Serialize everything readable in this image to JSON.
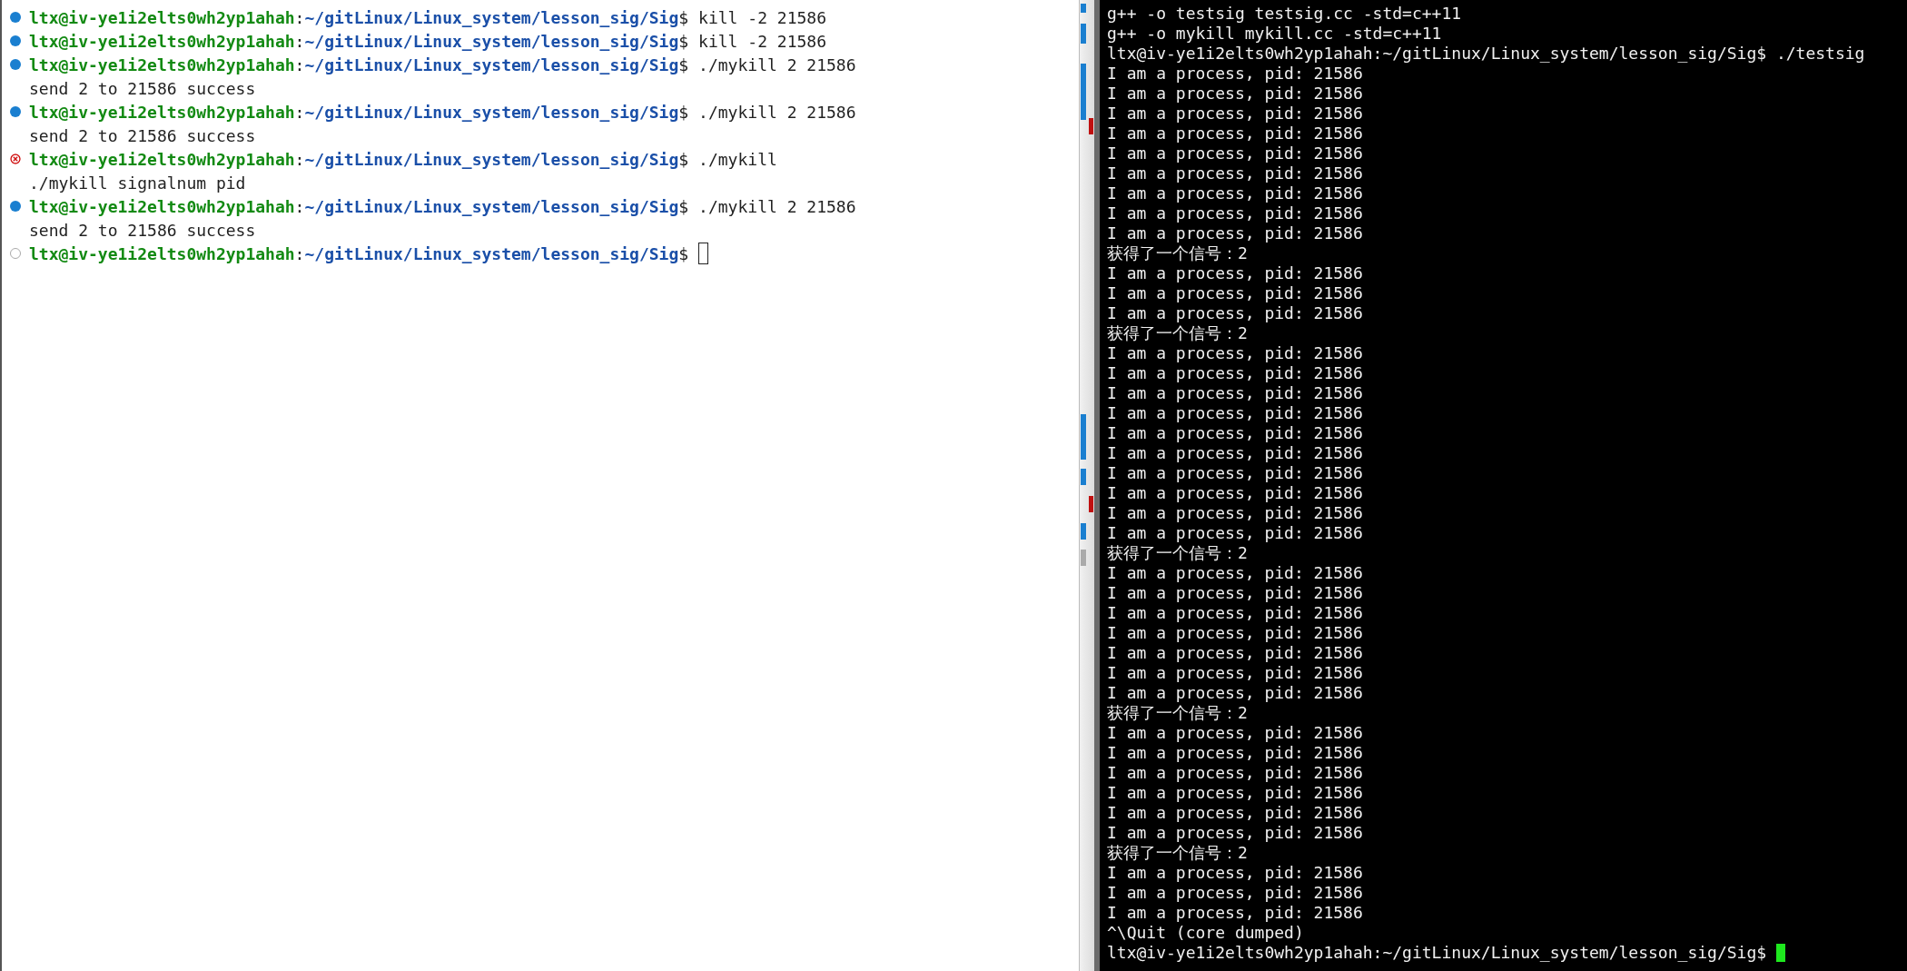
{
  "left_terminal": {
    "cursor": true,
    "lines": [
      {
        "kind": "prompt",
        "marker": {
          "kind": "success"
        },
        "user_host": "ltx@iv-ye1i2elts0wh2yp1ahah",
        "separator": ":",
        "path": "~/gitLinux/Linux_system/lesson_sig/Sig",
        "sigil": "$",
        "command": "kill -2 21586"
      },
      {
        "kind": "prompt",
        "marker": {
          "kind": "success"
        },
        "user_host": "ltx@iv-ye1i2elts0wh2yp1ahah",
        "separator": ":",
        "path": "~/gitLinux/Linux_system/lesson_sig/Sig",
        "sigil": "$",
        "command": "kill -2 21586"
      },
      {
        "kind": "prompt",
        "marker": {
          "kind": "success"
        },
        "user_host": "ltx@iv-ye1i2elts0wh2yp1ahah",
        "separator": ":",
        "path": "~/gitLinux/Linux_system/lesson_sig/Sig",
        "sigil": "$",
        "command": "./mykill 2 21586"
      },
      {
        "kind": "output",
        "text": "send 2 to 21586 success"
      },
      {
        "kind": "prompt",
        "marker": {
          "kind": "success"
        },
        "user_host": "ltx@iv-ye1i2elts0wh2yp1ahah",
        "separator": ":",
        "path": "~/gitLinux/Linux_system/lesson_sig/Sig",
        "sigil": "$",
        "command": "./mykill 2 21586"
      },
      {
        "kind": "output",
        "text": "send 2 to 21586 success"
      },
      {
        "kind": "prompt",
        "marker": {
          "kind": "error"
        },
        "user_host": "ltx@iv-ye1i2elts0wh2yp1ahah",
        "separator": ":",
        "path": "~/gitLinux/Linux_system/lesson_sig/Sig",
        "sigil": "$",
        "command": "./mykill"
      },
      {
        "kind": "output",
        "text": "./mykill signalnum pid"
      },
      {
        "kind": "prompt",
        "marker": {
          "kind": "success"
        },
        "user_host": "ltx@iv-ye1i2elts0wh2yp1ahah",
        "separator": ":",
        "path": "~/gitLinux/Linux_system/lesson_sig/Sig",
        "sigil": "$",
        "command": "./mykill 2 21586"
      },
      {
        "kind": "output",
        "text": "send 2 to 21586 success"
      },
      {
        "kind": "prompt",
        "marker": {
          "kind": "pending"
        },
        "user_host": "ltx@iv-ye1i2elts0wh2yp1ahah",
        "separator": ":",
        "path": "~/gitLinux/Linux_system/lesson_sig/Sig",
        "sigil": "$"
      }
    ]
  },
  "right_terminal": {
    "cursor": true,
    "lines": [
      "g++ -o testsig testsig.cc -std=c++11",
      "g++ -o mykill mykill.cc -std=c++11",
      "ltx@iv-ye1i2elts0wh2yp1ahah:~/gitLinux/Linux_system/lesson_sig/Sig$ ./testsig",
      "I am a process, pid: 21586",
      "I am a process, pid: 21586",
      "I am a process, pid: 21586",
      "I am a process, pid: 21586",
      "I am a process, pid: 21586",
      "I am a process, pid: 21586",
      "I am a process, pid: 21586",
      "I am a process, pid: 21586",
      "I am a process, pid: 21586",
      "获得了一个信号：2",
      "I am a process, pid: 21586",
      "I am a process, pid: 21586",
      "I am a process, pid: 21586",
      "获得了一个信号：2",
      "I am a process, pid: 21586",
      "I am a process, pid: 21586",
      "I am a process, pid: 21586",
      "I am a process, pid: 21586",
      "I am a process, pid: 21586",
      "I am a process, pid: 21586",
      "I am a process, pid: 21586",
      "I am a process, pid: 21586",
      "I am a process, pid: 21586",
      "I am a process, pid: 21586",
      "获得了一个信号：2",
      "I am a process, pid: 21586",
      "I am a process, pid: 21586",
      "I am a process, pid: 21586",
      "I am a process, pid: 21586",
      "I am a process, pid: 21586",
      "I am a process, pid: 21586",
      "I am a process, pid: 21586",
      "获得了一个信号：2",
      "I am a process, pid: 21586",
      "I am a process, pid: 21586",
      "I am a process, pid: 21586",
      "I am a process, pid: 21586",
      "I am a process, pid: 21586",
      "I am a process, pid: 21586",
      "获得了一个信号：2",
      "I am a process, pid: 21586",
      "I am a process, pid: 21586",
      "I am a process, pid: 21586",
      "^\\Quit (core dumped)",
      "ltx@iv-ye1i2elts0wh2yp1ahah:~/gitLinux/Linux_system/lesson_sig/Sig$ "
    ]
  }
}
